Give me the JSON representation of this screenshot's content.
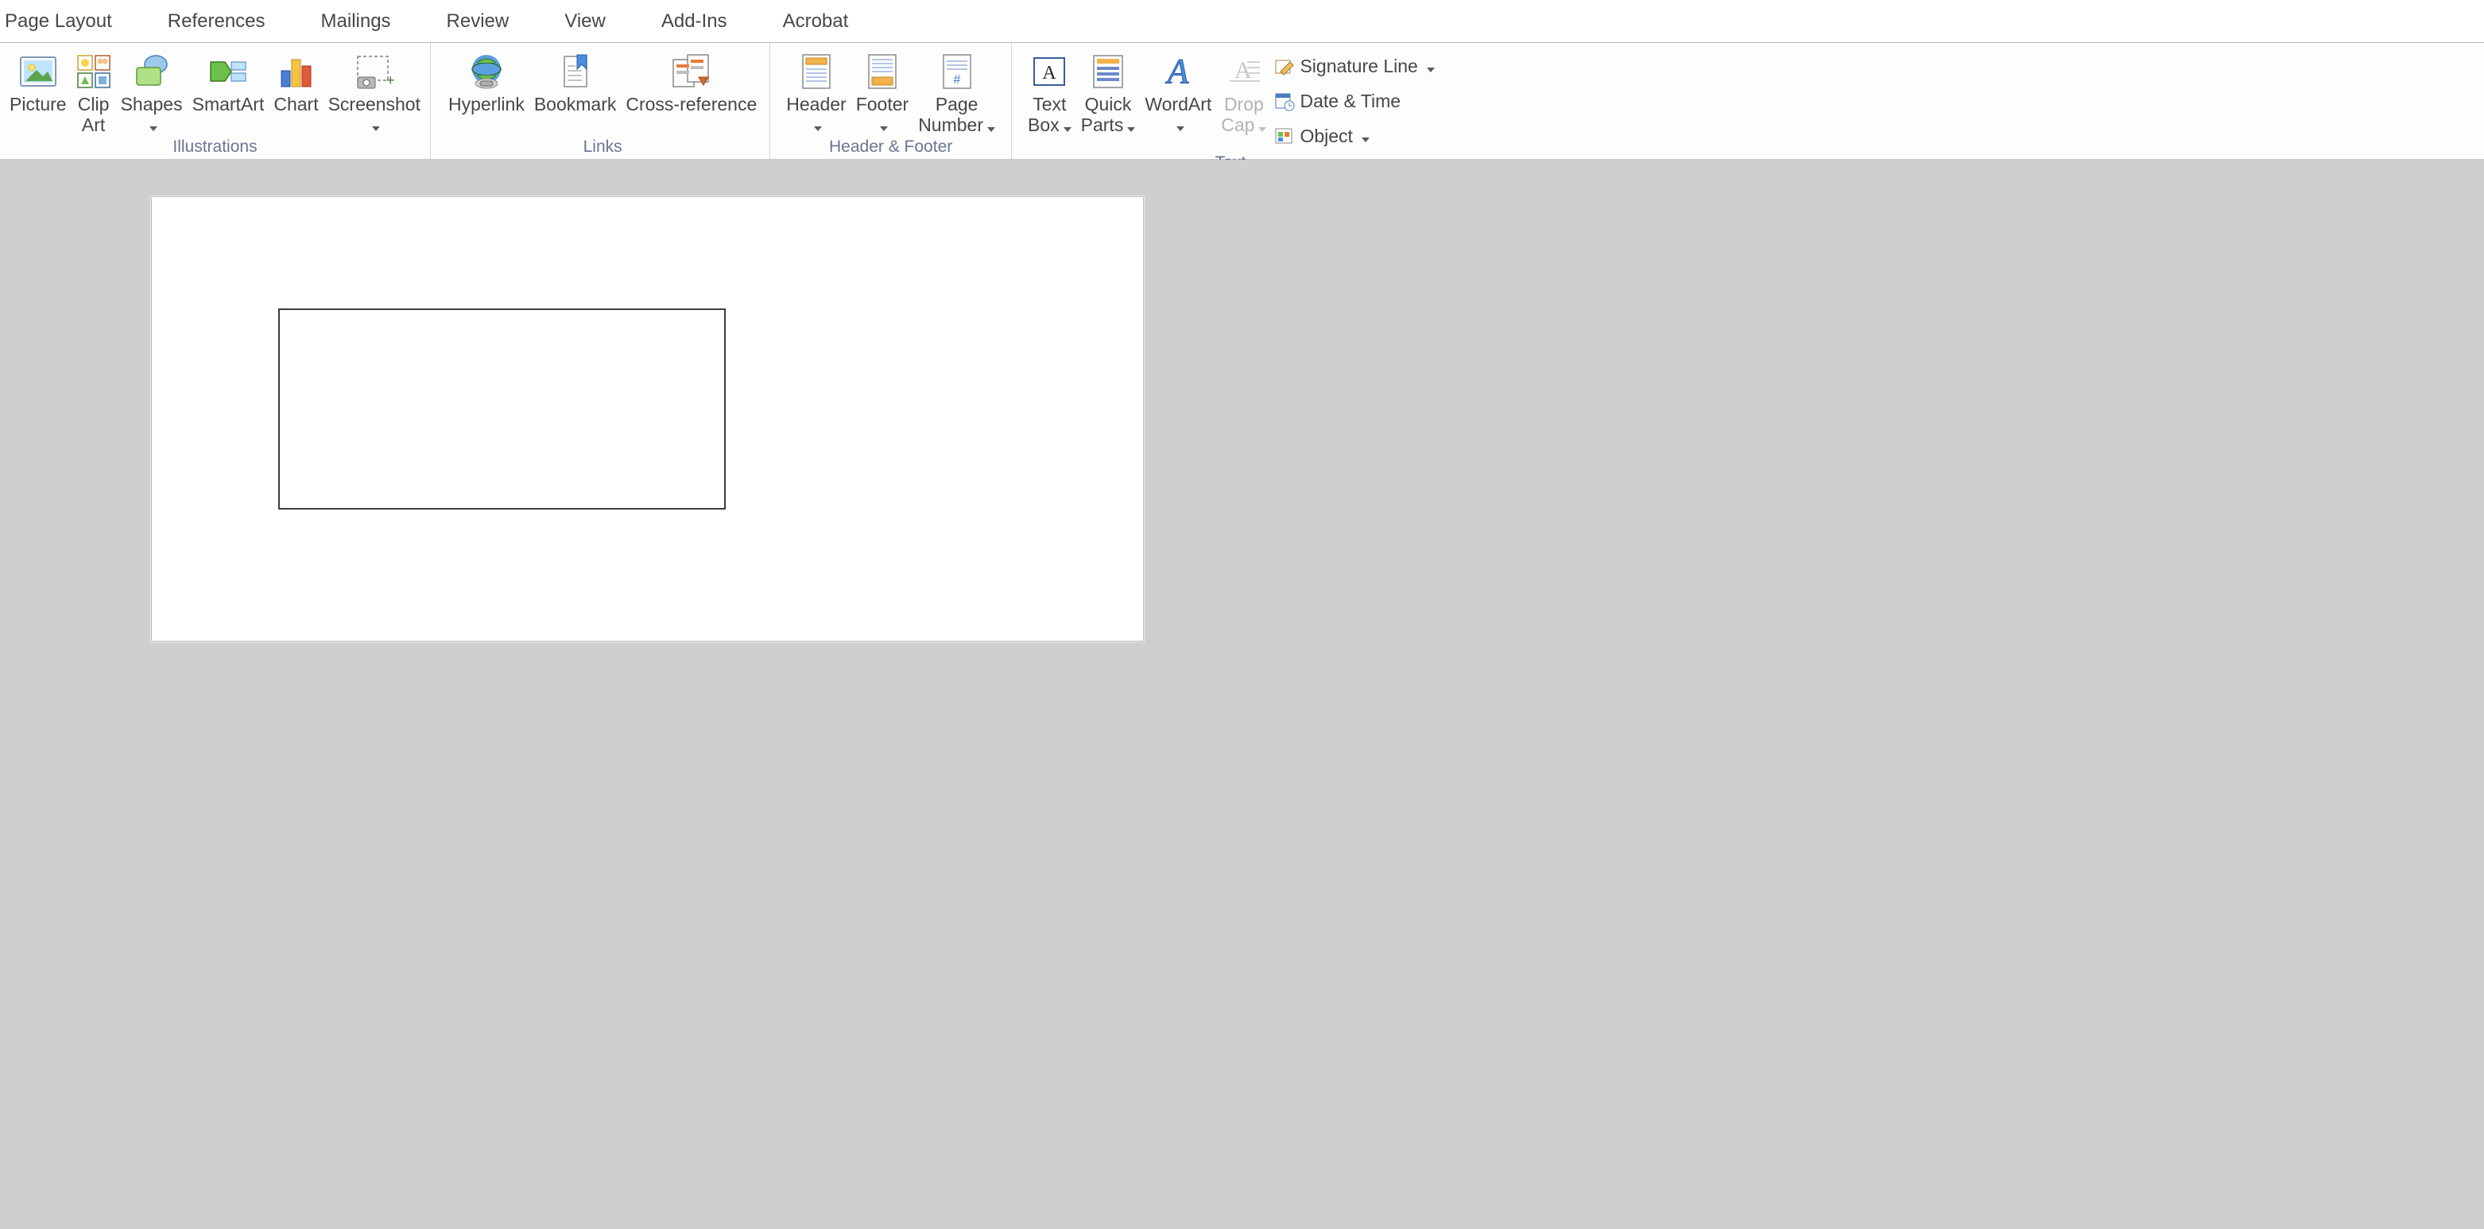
{
  "tabs": {
    "page_layout": "Page Layout",
    "references": "References",
    "mailings": "Mailings",
    "review": "Review",
    "view": "View",
    "addins": "Add-Ins",
    "acrobat": "Acrobat"
  },
  "groups": {
    "illustrations": {
      "label": "Illustrations",
      "picture": "Picture",
      "clipart_l1": "Clip",
      "clipart_l2": "Art",
      "shapes": "Shapes",
      "smartart": "SmartArt",
      "chart": "Chart",
      "screenshot": "Screenshot"
    },
    "links": {
      "label": "Links",
      "hyperlink": "Hyperlink",
      "bookmark": "Bookmark",
      "crossref": "Cross-reference"
    },
    "hf": {
      "label": "Header & Footer",
      "header": "Header",
      "footer": "Footer",
      "pagenum_l1": "Page",
      "pagenum_l2": "Number"
    },
    "text": {
      "label": "Text",
      "textbox_l1": "Text",
      "textbox_l2": "Box",
      "quickparts_l1": "Quick",
      "quickparts_l2": "Parts",
      "wordart": "WordArt",
      "dropcap_l1": "Drop",
      "dropcap_l2": "Cap",
      "sigline": "Signature Line",
      "datetime": "Date & Time",
      "object": "Object"
    }
  }
}
